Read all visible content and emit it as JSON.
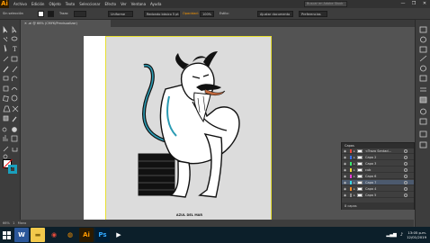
{
  "app": {
    "logo": "Ai",
    "menu": [
      "Archivo",
      "Edición",
      "Objeto",
      "Texto",
      "Seleccionar",
      "Efecto",
      "Ver",
      "Ventana",
      "Ayuda"
    ],
    "workspace_search": "Buscar en Adobe Stock",
    "window_controls": [
      "—",
      "❐",
      "✕"
    ]
  },
  "controlbar": {
    "selection": "Sin selección",
    "stroke_label": "Trazo:",
    "stroke_weight": "",
    "uniform": "Uniforme",
    "brush": "Redondo básico 5 pt",
    "style_label": "Estilo:",
    "opacity_label": "Opacidad:",
    "opacity": "100%",
    "doc_setup": "Ajustar documento",
    "prefs": "Preferencias",
    "accent": "#ff9a00"
  },
  "document": {
    "tab_label": "✕  .ai @ 66% (CMYK/Previsualizar)",
    "caption": "AZUL DEL MAR",
    "artboard_bg": "#dcdcdc",
    "figure_stroke": "#1a1a1a",
    "figure_accent": "#2b9bb3",
    "tongue_color": "#c46a3e"
  },
  "tools": {
    "icons": [
      "selection-arrow-icon",
      "direct-select-icon",
      "magic-wand-icon",
      "lasso-icon",
      "pen-icon",
      "type-icon",
      "line-icon",
      "rectangle-icon",
      "paintbrush-icon",
      "pencil-icon",
      "eraser-icon",
      "rotate-icon",
      "scale-icon",
      "width-icon",
      "free-transform-icon",
      "shape-builder-icon",
      "perspective-icon",
      "mesh-icon",
      "gradient-icon",
      "eyedropper-icon",
      "blend-icon",
      "symbol-sprayer-icon",
      "graph-icon",
      "artboard-icon",
      "slice-icon",
      "hand-icon",
      "zoom-icon"
    ],
    "fill_color": "#ffffff",
    "stroke_color": "#1a9fbd"
  },
  "layers": {
    "title": "Capas",
    "rows": [
      {
        "name": "<Trazo Sentad...",
        "color": "#e8463a"
      },
      {
        "name": "Capa 2",
        "color": "#3a6ee8"
      },
      {
        "name": "Capa 3",
        "color": "#3ae86e"
      },
      {
        "name": "cub",
        "color": "#e8d83a"
      },
      {
        "name": "Capa 6",
        "color": "#e83ad8"
      },
      {
        "name": "Capa 7",
        "color": "#3ad8e8"
      },
      {
        "name": "Capa 4",
        "color": "#ee8a2a"
      },
      {
        "name": "Capa 5",
        "color": "#8a8a8a"
      }
    ],
    "footer": "8 capas"
  },
  "status": {
    "zoom": "66%",
    "page": "1",
    "tool": "Mano"
  },
  "taskbar": {
    "apps": [
      {
        "icon": "windows-start-icon",
        "label": "⊞",
        "bg": "#0c1f2a",
        "fg": "#ffffff"
      },
      {
        "icon": "word-icon",
        "label": "W",
        "bg": "#2b579a",
        "fg": "#ffffff"
      },
      {
        "icon": "file-explorer-icon",
        "label": "▬",
        "bg": "#f2c94c",
        "fg": "#8a6a10"
      },
      {
        "icon": "chrome-icon",
        "label": "◉",
        "bg": "#0c1f2a",
        "fg": "#e74c3c"
      },
      {
        "icon": "firefox-icon",
        "label": "◍",
        "bg": "#0c1f2a",
        "fg": "#ff9500"
      },
      {
        "icon": "illustrator-icon",
        "label": "Ai",
        "bg": "#2b1a00",
        "fg": "#ff9a00"
      },
      {
        "icon": "photoshop-icon",
        "label": "Ps",
        "bg": "#001d34",
        "fg": "#31a8ff"
      },
      {
        "icon": "media-icon",
        "label": "▶",
        "bg": "#0c1f2a",
        "fg": "#ffffff"
      }
    ],
    "time": "13:05 p.m.",
    "date": "12/01/2019"
  }
}
